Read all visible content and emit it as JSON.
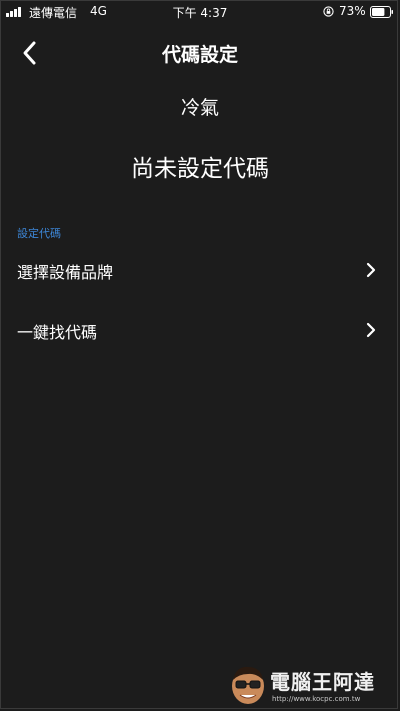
{
  "status_bar": {
    "carrier": "遠傳電信",
    "network": "4G",
    "time": "下午 4:37",
    "battery_percent": "73%",
    "battery_level": 0.73,
    "signal_bars": 4
  },
  "nav": {
    "title": "代碼設定",
    "back_icon": "chevron-left-icon"
  },
  "device": {
    "name": "冷氣",
    "code_status": "尚未設定代碼"
  },
  "section": {
    "header": "設定代碼",
    "items": [
      {
        "label": "選擇設備品牌",
        "icon": "chevron-right-icon"
      },
      {
        "label": "一鍵找代碼",
        "icon": "chevron-right-icon"
      }
    ]
  },
  "watermark": {
    "text": "電腦王阿達",
    "url": "http://www.kocpc.com.tw"
  },
  "colors": {
    "background": "#1c1c1c",
    "accent": "#3d86d6",
    "text": "#ffffff"
  }
}
